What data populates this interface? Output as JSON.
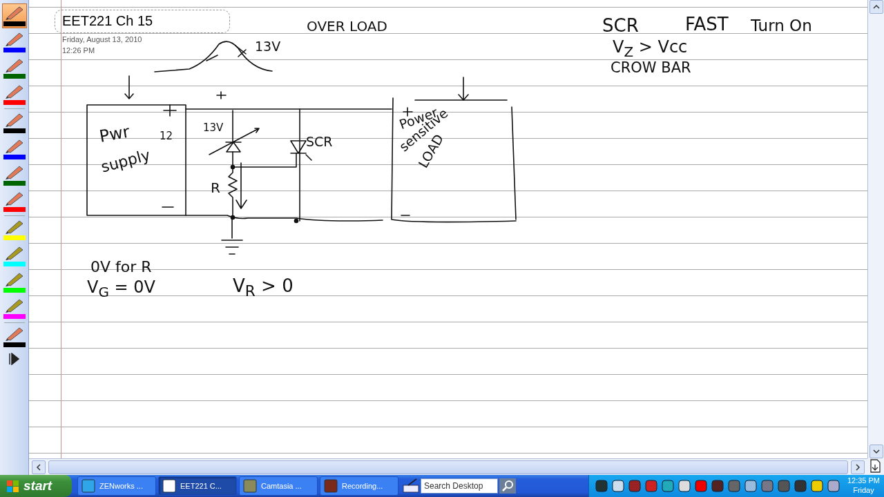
{
  "pens": [
    {
      "kind": "pen",
      "color": "#000000",
      "selected": true
    },
    {
      "kind": "pen",
      "color": "#0000ff",
      "selected": false
    },
    {
      "kind": "pen",
      "color": "#006400",
      "selected": false
    },
    {
      "kind": "pen",
      "color": "#ff0000",
      "selected": false
    },
    {
      "kind": "pen",
      "color": "#000000",
      "selected": false
    },
    {
      "kind": "pen",
      "color": "#0000ff",
      "selected": false
    },
    {
      "kind": "pen",
      "color": "#006400",
      "selected": false
    },
    {
      "kind": "pen",
      "color": "#ff0000",
      "selected": false
    },
    {
      "kind": "highlighter",
      "color": "#ffff00",
      "selected": false
    },
    {
      "kind": "highlighter",
      "color": "#00ffff",
      "selected": false
    },
    {
      "kind": "highlighter",
      "color": "#00ff00",
      "selected": false
    },
    {
      "kind": "highlighter",
      "color": "#ff00ff",
      "selected": false
    },
    {
      "kind": "pen",
      "color": "#000000",
      "selected": false
    }
  ],
  "page": {
    "title": "EET221 Ch 15",
    "date": "Friday, August 13, 2010",
    "time": "12:26 PM",
    "ink": [
      "OVER LOAD",
      "SCR",
      "FAST",
      "Turn On",
      "V$_{Z}$ > Vcc",
      "CROW BAR",
      "13V",
      "Pwr",
      "supply",
      "12",
      "13V",
      "SCR",
      "R",
      "Power",
      "sensitive",
      "LOAD",
      "0V for R",
      "V$_{G}$ = 0V",
      "V$_{R}$ > 0"
    ]
  },
  "taskbar": {
    "start": "start",
    "tasks": [
      {
        "label": "ZENworks ...",
        "selected": false
      },
      {
        "label": "EET221 C...",
        "selected": true
      },
      {
        "label": "Camtasia ...",
        "selected": false
      },
      {
        "label": "Recording...",
        "selected": false
      }
    ],
    "search": {
      "placeholder": "Search Desktop"
    },
    "clock": "12:35 PM",
    "day": "Friday"
  }
}
